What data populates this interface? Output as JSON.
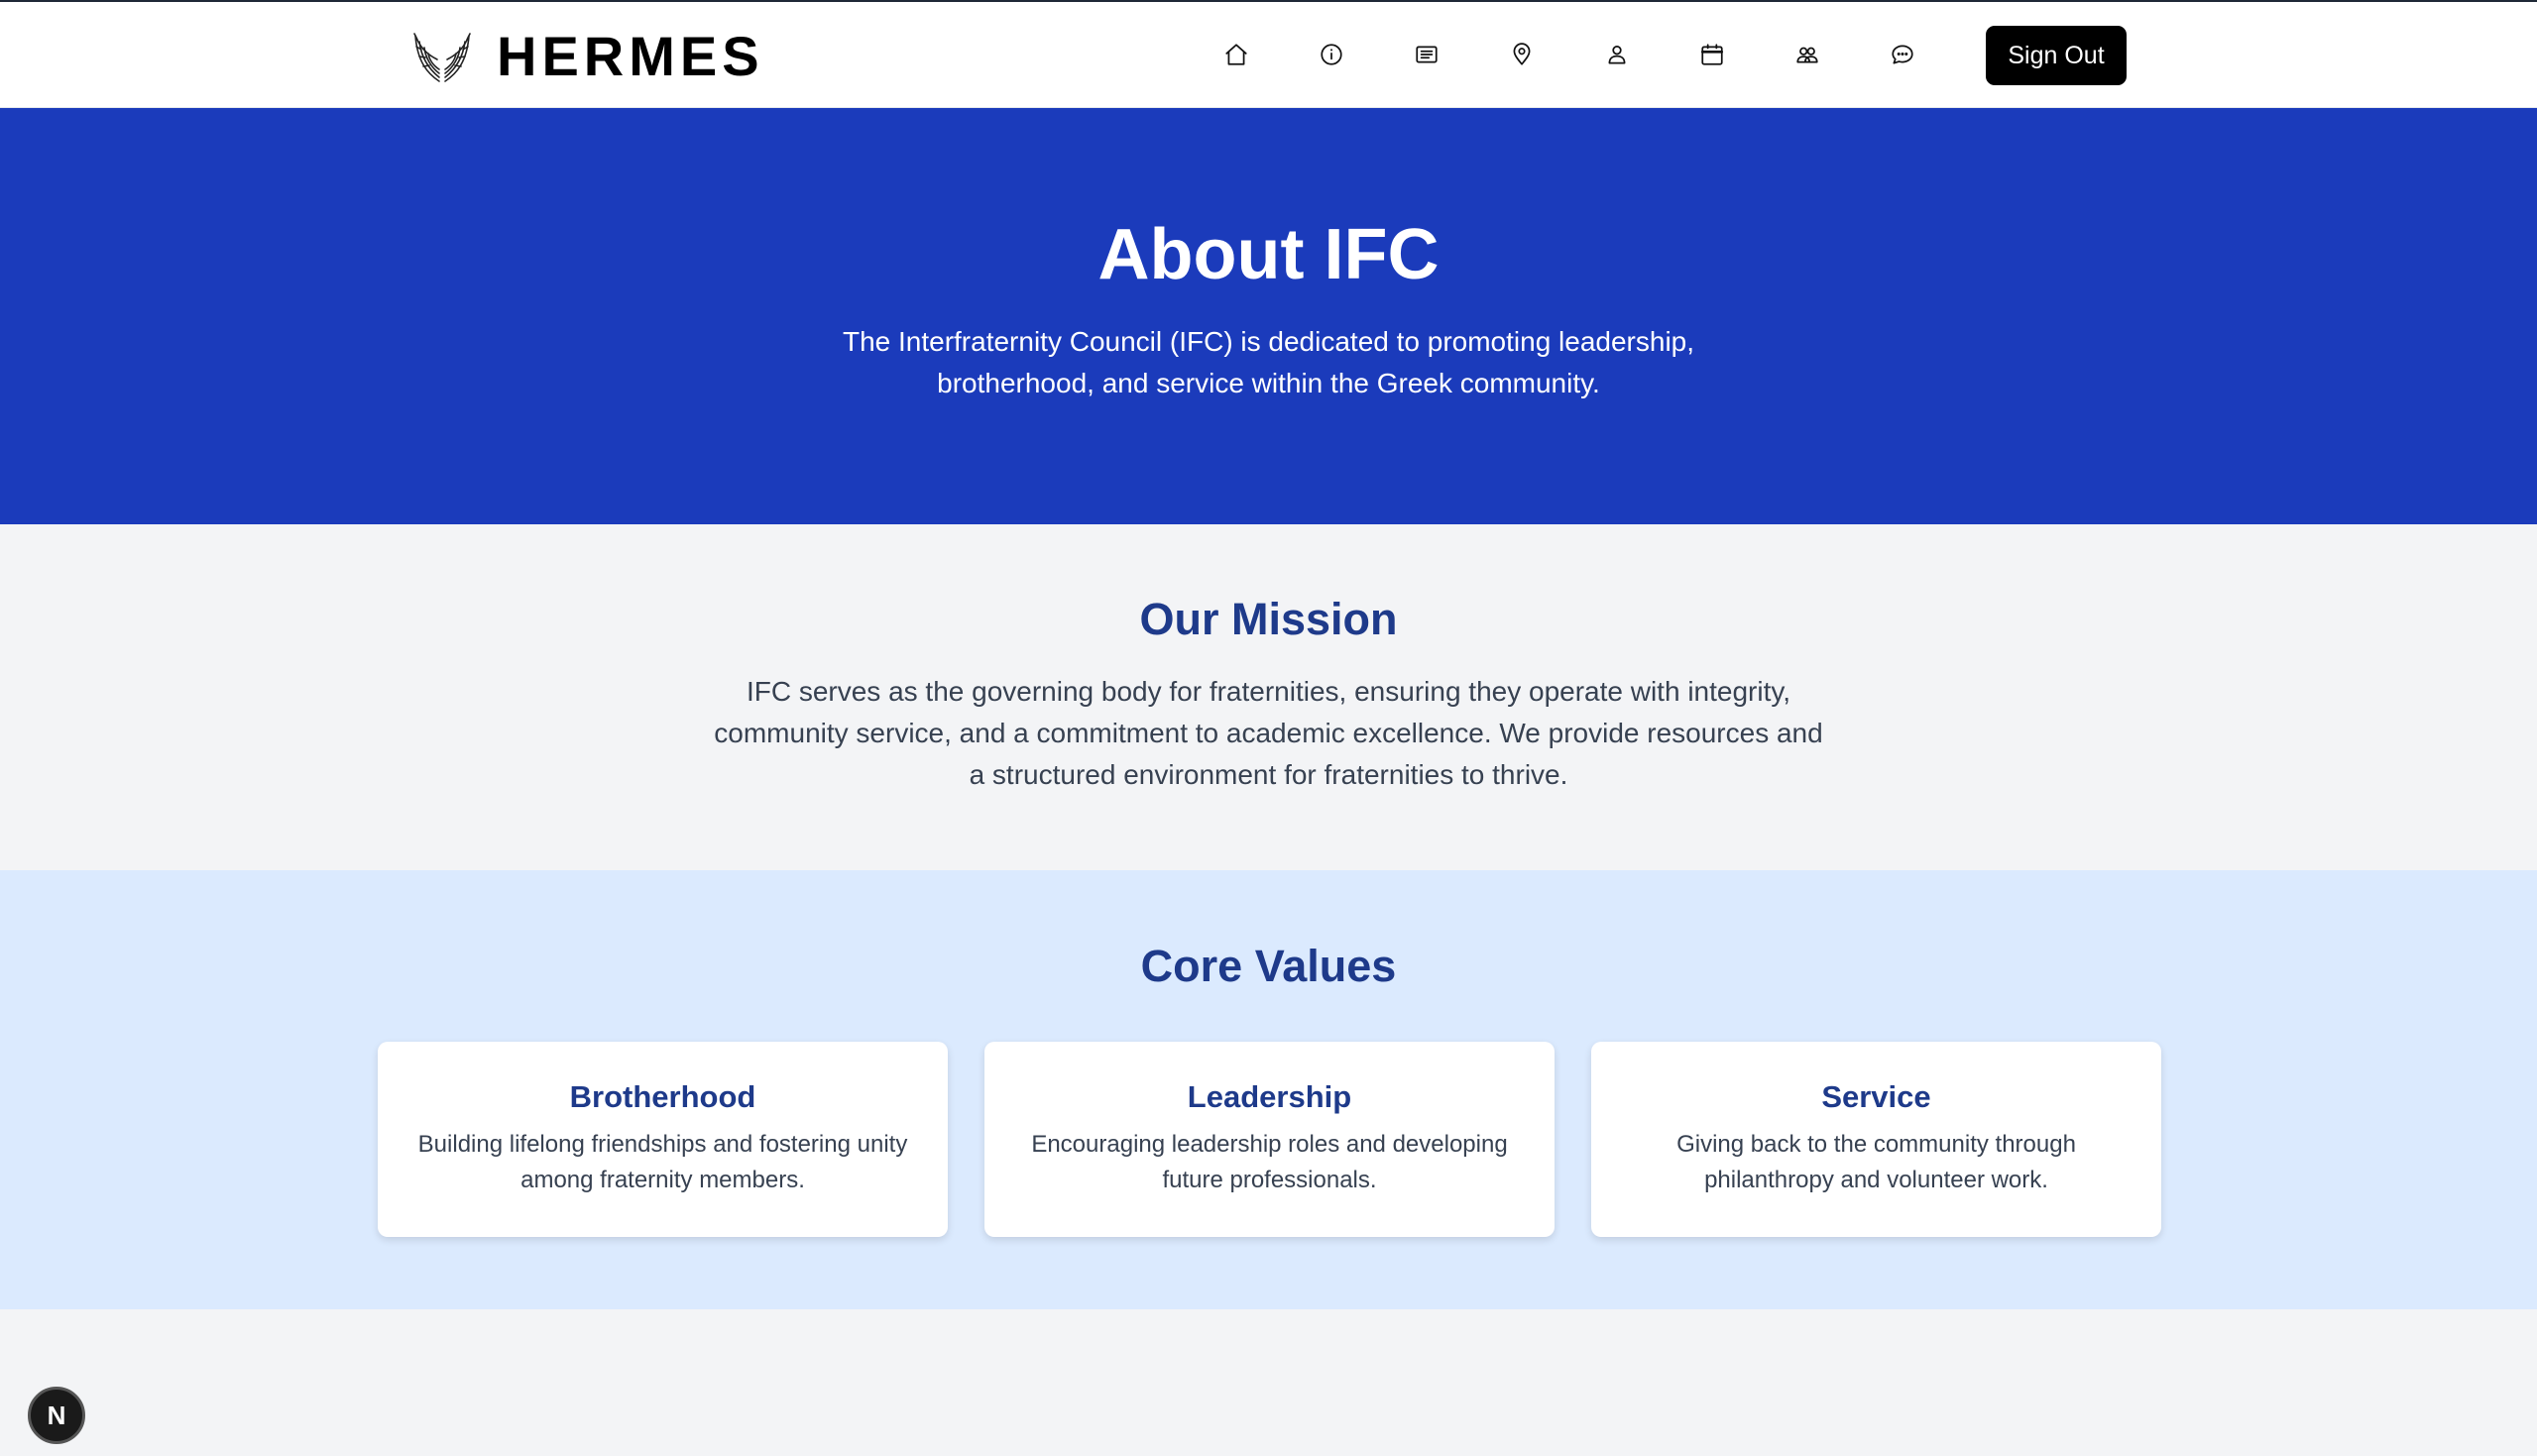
{
  "brand": {
    "name": "HERMES"
  },
  "nav": {
    "icons": [
      "home-icon",
      "info-icon",
      "news-icon",
      "location-icon",
      "profile-icon",
      "calendar-icon",
      "chapters-icon",
      "chat-icon"
    ],
    "signout_label": "Sign Out"
  },
  "hero": {
    "title": "About IFC",
    "description": "The Interfraternity Council (IFC) is dedicated to promoting leadership, brotherhood, and service within the Greek community."
  },
  "mission": {
    "title": "Our Mission",
    "text": "IFC serves as the governing body for fraternities, ensuring they operate with integrity, community service, and a commitment to academic excellence. We provide resources and a structured environment for fraternities to thrive."
  },
  "values": {
    "title": "Core Values",
    "cards": [
      {
        "title": "Brotherhood",
        "text": "Building lifelong friendships and fostering unity among fraternity members."
      },
      {
        "title": "Leadership",
        "text": "Encouraging leadership roles and developing future professionals."
      },
      {
        "title": "Service",
        "text": "Giving back to the community through philanthropy and volunteer work."
      }
    ]
  },
  "dev_badge": {
    "label": "N"
  },
  "colors": {
    "hero_bg": "#1b3bbb",
    "heading": "#1e3a8a",
    "values_bg": "#dbeafe",
    "page_bg": "#f3f4f6",
    "signout_bg": "#000000"
  }
}
